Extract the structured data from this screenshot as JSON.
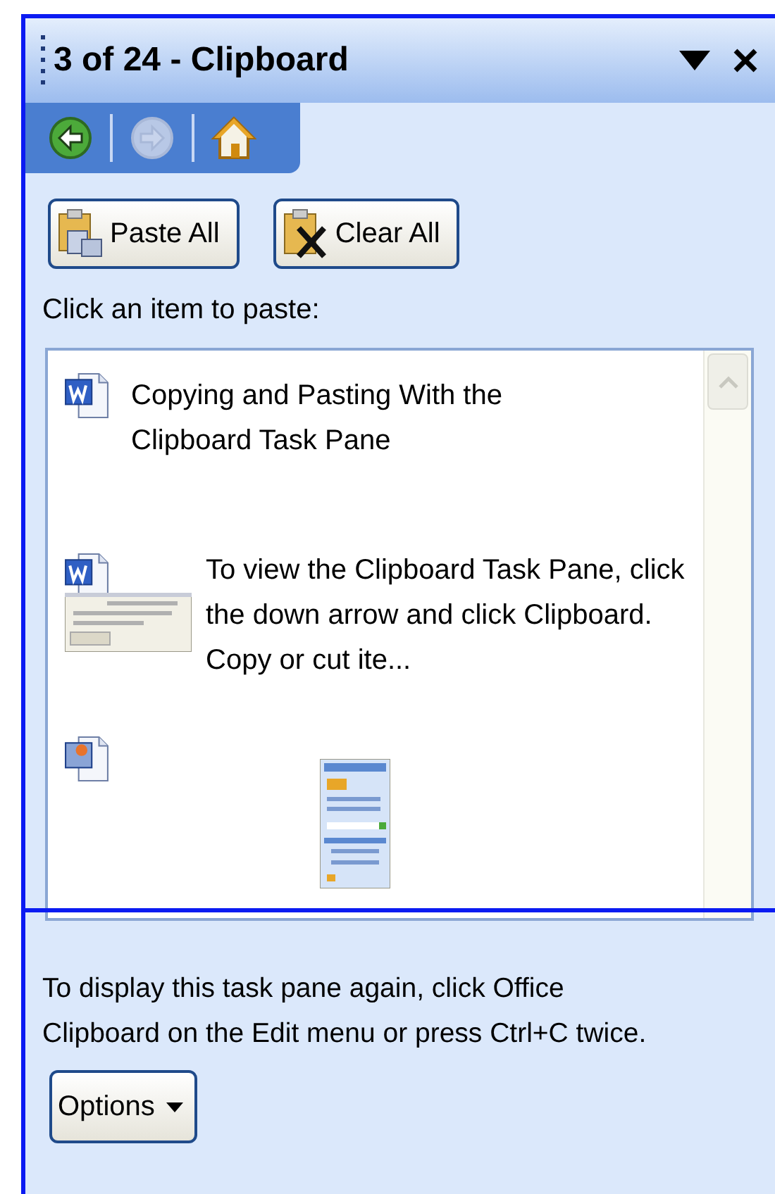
{
  "title": "3 of 24 - Clipboard",
  "nav": [
    {
      "kind": "back",
      "disabled": false
    },
    {
      "kind": "forward",
      "disabled": true
    },
    {
      "kind": "home",
      "disabled": false
    }
  ],
  "buttons": [
    {
      "kind": "paste",
      "label": "Paste All"
    },
    {
      "kind": "clear",
      "label": "Clear All"
    }
  ],
  "instruction": "Click an item to paste:",
  "items": [
    {
      "kind": "text",
      "text": "Copying and Pasting With the Clipboard Task Pane"
    },
    {
      "kind": "text_with_thumbnail",
      "text": "To view the Clipboard Task Pane, click the down arrow and click Clipboard. Copy or cut ite..."
    },
    {
      "kind": "picture"
    }
  ],
  "footer_text": "To display this task pane again, click Office Clipboard on the Edit menu or press Ctrl+C twice.",
  "options_button": "Options"
}
